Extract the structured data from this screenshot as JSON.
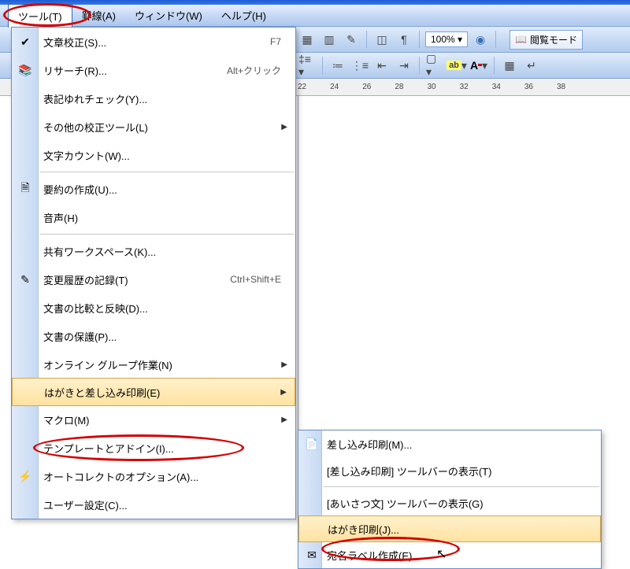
{
  "menubar": {
    "tools": "ツール(T)",
    "lines": "罫線(A)",
    "window": "ウィンドウ(W)",
    "help": "ヘルプ(H)"
  },
  "toolbar": {
    "zoom": "100%",
    "reading_mode": "閲覧モード"
  },
  "ruler": {
    "marks": [
      "22",
      "24",
      "26",
      "28",
      "30",
      "32",
      "34",
      "36",
      "38"
    ]
  },
  "menu": {
    "items": [
      {
        "label": "文章校正(S)...",
        "shortcut": "F7",
        "icon": "check"
      },
      {
        "label": "リサーチ(R)...",
        "shortcut": "Alt+クリック",
        "icon": "book"
      },
      {
        "label": "表記ゆれチェック(Y)..."
      },
      {
        "label": "その他の校正ツール(L)",
        "arrow": true
      },
      {
        "label": "文字カウント(W)..."
      },
      {
        "sep": true
      },
      {
        "label": "要約の作成(U)...",
        "icon": "summary"
      },
      {
        "label": "音声(H)"
      },
      {
        "sep": true
      },
      {
        "label": "共有ワークスペース(K)..."
      },
      {
        "label": "変更履歴の記録(T)",
        "shortcut": "Ctrl+Shift+E",
        "icon": "track"
      },
      {
        "label": "文書の比較と反映(D)..."
      },
      {
        "label": "文書の保護(P)..."
      },
      {
        "label": "オンライン グループ作業(N)",
        "arrow": true
      },
      {
        "label": "はがきと差し込み印刷(E)",
        "arrow": true,
        "highlight": true
      },
      {
        "label": "マクロ(M)",
        "arrow": true
      },
      {
        "label": "テンプレートとアドイン(I)..."
      },
      {
        "label": "オートコレクトのオプション(A)...",
        "icon": "auto"
      },
      {
        "label": "ユーザー設定(C)..."
      }
    ]
  },
  "submenu": {
    "items": [
      {
        "label": "差し込み印刷(M)...",
        "icon": "merge"
      },
      {
        "label": "[差し込み印刷] ツールバーの表示(T)"
      },
      {
        "sep": true
      },
      {
        "label": "[あいさつ文] ツールバーの表示(G)"
      },
      {
        "label": "はがき印刷(J)...",
        "highlight": true
      },
      {
        "label": "宛名ラベル作成(E)...",
        "icon": "label"
      }
    ]
  }
}
